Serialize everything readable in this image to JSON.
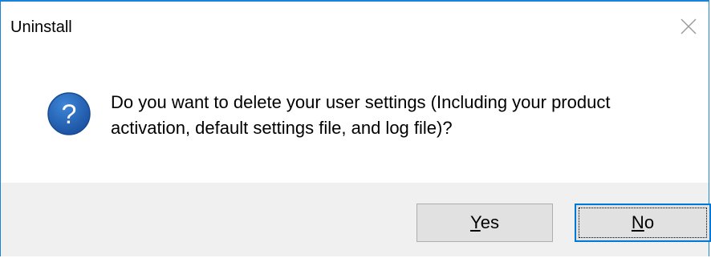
{
  "window": {
    "title": "Uninstall"
  },
  "dialog": {
    "icon": "question-icon",
    "message_line1": "Do you want to delete your user settings (Including your product",
    "message_line2": "activation, default settings file, and log file)?"
  },
  "buttons": {
    "yes": {
      "mnemonic": "Y",
      "rest": "es"
    },
    "no": {
      "mnemonic": "N",
      "rest": "o"
    }
  },
  "colors": {
    "accent": "#0078d7",
    "border": "#1883d7",
    "icon_blue": "#1d5fb3",
    "footer_bg": "#f0f0f0",
    "button_bg": "#e1e1e1"
  }
}
